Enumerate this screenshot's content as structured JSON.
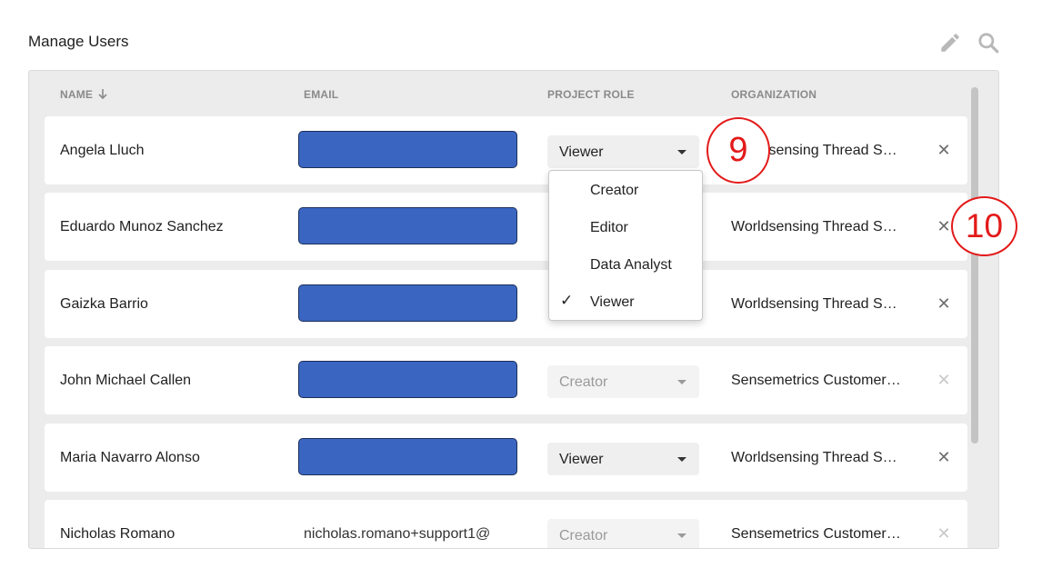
{
  "header": {
    "title": "Manage Users",
    "icons": [
      "pencil-icon",
      "search-icon"
    ]
  },
  "table": {
    "columns": {
      "name": "NAME",
      "email": "EMAIL",
      "role": "PROJECT ROLE",
      "organization": "ORGANIZATION"
    },
    "sort_icon": "arrow-down-icon",
    "rows": [
      {
        "name": "Angela Lluch",
        "email_redacted": true,
        "role": "Viewer",
        "role_editable": true,
        "organization": "Worldsensing Thread S…",
        "removable": true
      },
      {
        "name": "Eduardo Munoz Sanchez",
        "email_redacted": true,
        "role": "",
        "role_editable": true,
        "organization": "Worldsensing Thread S…",
        "removable": true
      },
      {
        "name": "Gaizka Barrio",
        "email_redacted": true,
        "role": "",
        "role_editable": true,
        "organization": "Worldsensing Thread S…",
        "removable": true
      },
      {
        "name": "John Michael Callen",
        "email_redacted": true,
        "role": "Creator",
        "role_editable": false,
        "organization": "Sensemetrics Customer…",
        "removable": false
      },
      {
        "name": "Maria Navarro Alonso",
        "email_redacted": true,
        "role": "Viewer",
        "role_editable": true,
        "organization": "Worldsensing Thread S…",
        "removable": true
      },
      {
        "name": "Nicholas Romano",
        "email": "nicholas.romano+support1@",
        "role": "Creator",
        "role_editable": false,
        "organization": "Sensemetrics Customer…",
        "removable": false
      }
    ]
  },
  "role_dropdown": {
    "options": [
      "Creator",
      "Editor",
      "Data Analyst",
      "Viewer"
    ],
    "selected": "Viewer",
    "check_icon": "checkmark-icon"
  },
  "annotations": {
    "callout_9": "9",
    "callout_10": "10",
    "color": "#e31a1a"
  },
  "colors": {
    "redaction_fill": "#3a66c1",
    "panel_bg": "#ececec"
  }
}
